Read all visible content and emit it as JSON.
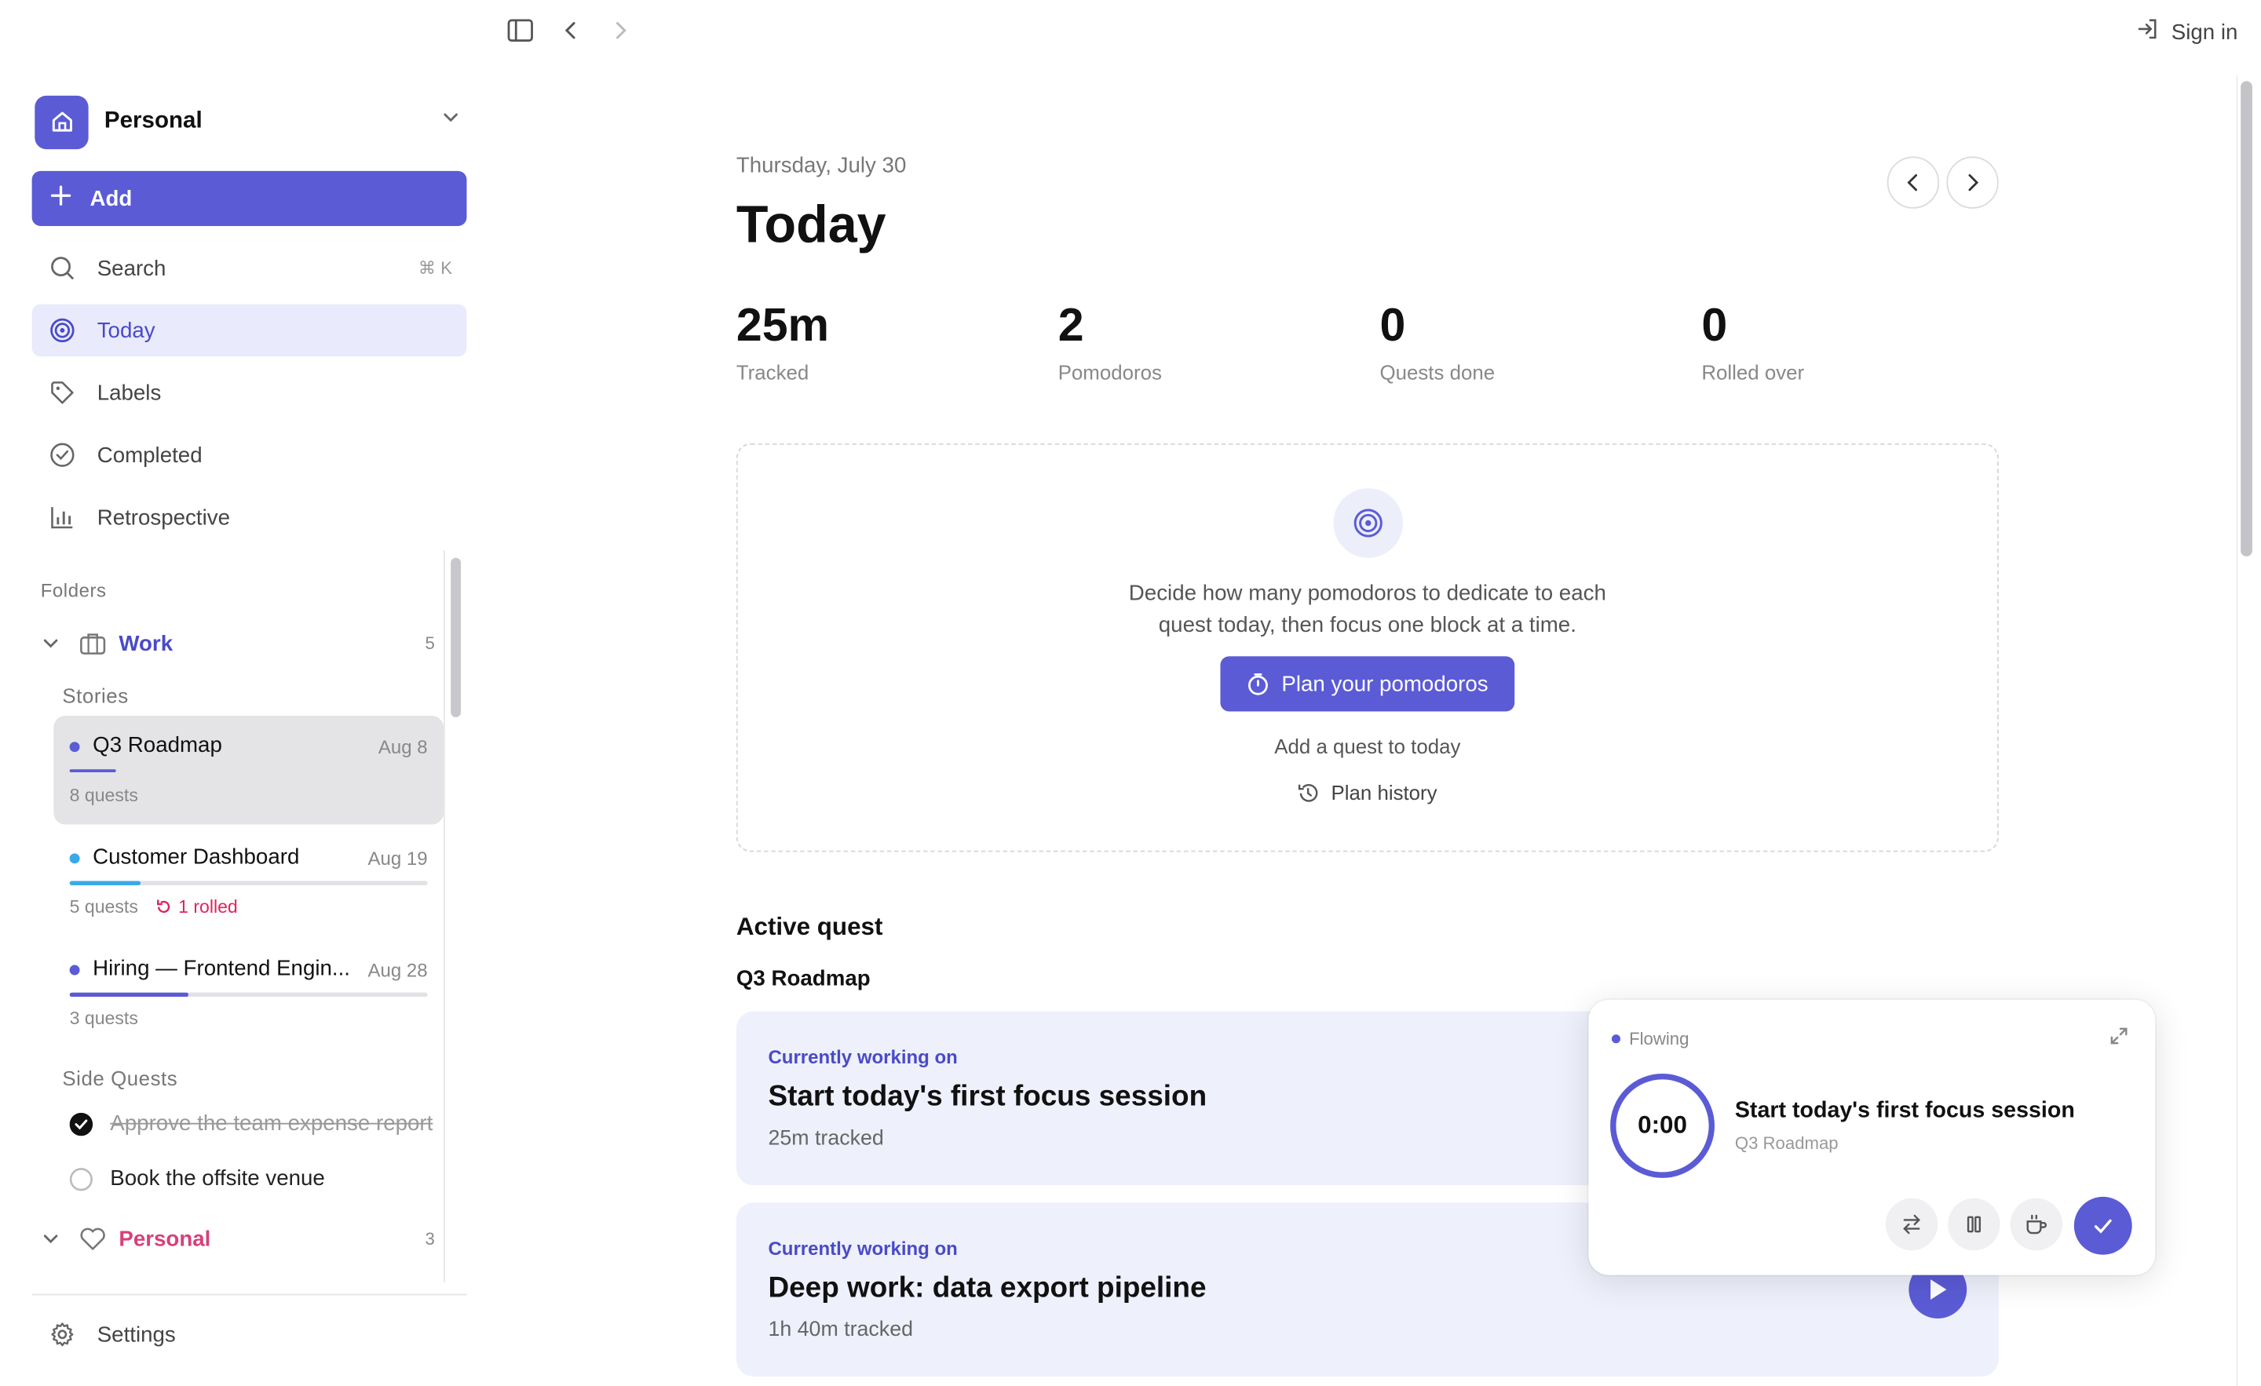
{
  "topbar": {
    "sign_in": "Sign in",
    "icons": [
      "sidebar-toggle-icon",
      "back-icon",
      "forward-icon"
    ]
  },
  "sidebar": {
    "workspace": "Personal",
    "add_label": "Add",
    "nav": [
      {
        "label": "Search",
        "shortcut": "⌘ K",
        "icon": "search-icon"
      },
      {
        "label": "Today",
        "icon": "target-icon",
        "active": true
      },
      {
        "label": "Labels",
        "icon": "tag-icon"
      },
      {
        "label": "Completed",
        "icon": "check-circle-icon"
      },
      {
        "label": "Retrospective",
        "icon": "bar-chart-icon"
      }
    ],
    "folders_label": "Folders",
    "work_folder": {
      "name": "Work",
      "count": "5",
      "stories_label": "Stories"
    },
    "stories": [
      {
        "title": "Q3 Roadmap",
        "date": "Aug 8",
        "meta": "8 quests",
        "color": "#5b5bd6",
        "progress": 0.13
      },
      {
        "title": "Customer Dashboard",
        "date": "Aug 19",
        "meta": "5 quests",
        "rolled": "1 rolled",
        "color": "#3aa9e8",
        "progress": 0.2
      },
      {
        "title": "Hiring — Frontend Engin...",
        "date": "Aug 28",
        "meta": "3 quests",
        "color": "#5b5bd6",
        "progress": 0.33
      }
    ],
    "side_quests_label": "Side Quests",
    "side_quests": [
      {
        "label": "Approve the team expense report",
        "done": true
      },
      {
        "label": "Book the offsite venue",
        "done": false
      }
    ],
    "personal_folder": {
      "name": "Personal",
      "count": "3"
    },
    "settings_label": "Settings"
  },
  "main": {
    "date": "Thursday, July 30",
    "title": "Today",
    "stats": [
      {
        "value": "25m",
        "label": "Tracked"
      },
      {
        "value": "2",
        "label": "Pomodoros"
      },
      {
        "value": "0",
        "label": "Quests done"
      },
      {
        "value": "0",
        "label": "Rolled over"
      }
    ],
    "plan": {
      "text": "Decide how many pomodoros to dedicate to each quest today, then focus one block at a time.",
      "button": "Plan your pomodoros",
      "add_quest": "Add a quest to today",
      "history": "Plan history"
    },
    "active_heading": "Active quest",
    "active_story": "Q3 Roadmap",
    "quests": [
      {
        "kicker": "Currently working on",
        "title": "Start today's first focus session",
        "meta": "25m tracked"
      },
      {
        "kicker": "Currently working on",
        "title": "Deep work: data export pipeline",
        "meta": "1h 40m tracked"
      }
    ]
  },
  "timer": {
    "status": "Flowing",
    "time": "0:00",
    "title": "Start today's first focus session",
    "story": "Q3 Roadmap"
  },
  "colors": {
    "accent": "#5b5bd6",
    "rolled": "#e0245e",
    "personal": "#d6417a"
  }
}
